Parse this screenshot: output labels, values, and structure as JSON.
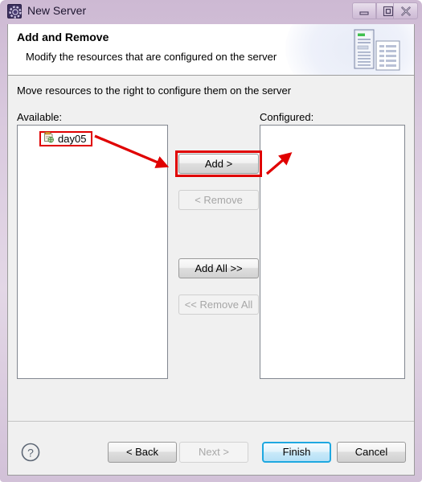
{
  "window": {
    "title": "New Server",
    "icon": "server-gear-icon",
    "controls": {
      "minimize": "minimize-icon",
      "maximize": "restore-icon",
      "close": "close-icon"
    }
  },
  "header": {
    "title": "Add and Remove",
    "subtitle": "Modify the resources that are configured on the server",
    "icon": "server-document-icon"
  },
  "main": {
    "instruction": "Move resources to the right to configure them on the server",
    "available": {
      "label": "Available:",
      "items": [
        {
          "name": "day05",
          "icon": "web-module-icon",
          "highlighted": true
        }
      ]
    },
    "configured": {
      "label": "Configured:",
      "items": []
    },
    "transfer_buttons": [
      {
        "label": "Add >",
        "enabled": true,
        "highlighted": true
      },
      {
        "label": "< Remove",
        "enabled": false,
        "highlighted": false
      },
      {
        "label": "Add All >>",
        "enabled": true,
        "highlighted": false
      },
      {
        "label": "<< Remove All",
        "enabled": false,
        "highlighted": false
      }
    ]
  },
  "footer": {
    "help": "help-icon",
    "buttons": [
      {
        "label": "< Back",
        "enabled": true,
        "primary": false
      },
      {
        "label": "Next >",
        "enabled": false,
        "primary": false
      },
      {
        "label": "Finish",
        "enabled": true,
        "primary": true
      },
      {
        "label": "Cancel",
        "enabled": true,
        "primary": false
      }
    ]
  },
  "annotations": {
    "highlight_color": "#e00000",
    "arrows": [
      {
        "name": "arrow-item-to-add",
        "from": "day05 item",
        "to": "Add button"
      },
      {
        "name": "arrow-add-to-configured",
        "from": "Add button",
        "to": "Configured list"
      }
    ]
  },
  "colors": {
    "accent": "#1ea8e0",
    "annotation": "#e00000",
    "dialog_bg": "#f0f0f0",
    "titlebar": "#d9c9de"
  }
}
